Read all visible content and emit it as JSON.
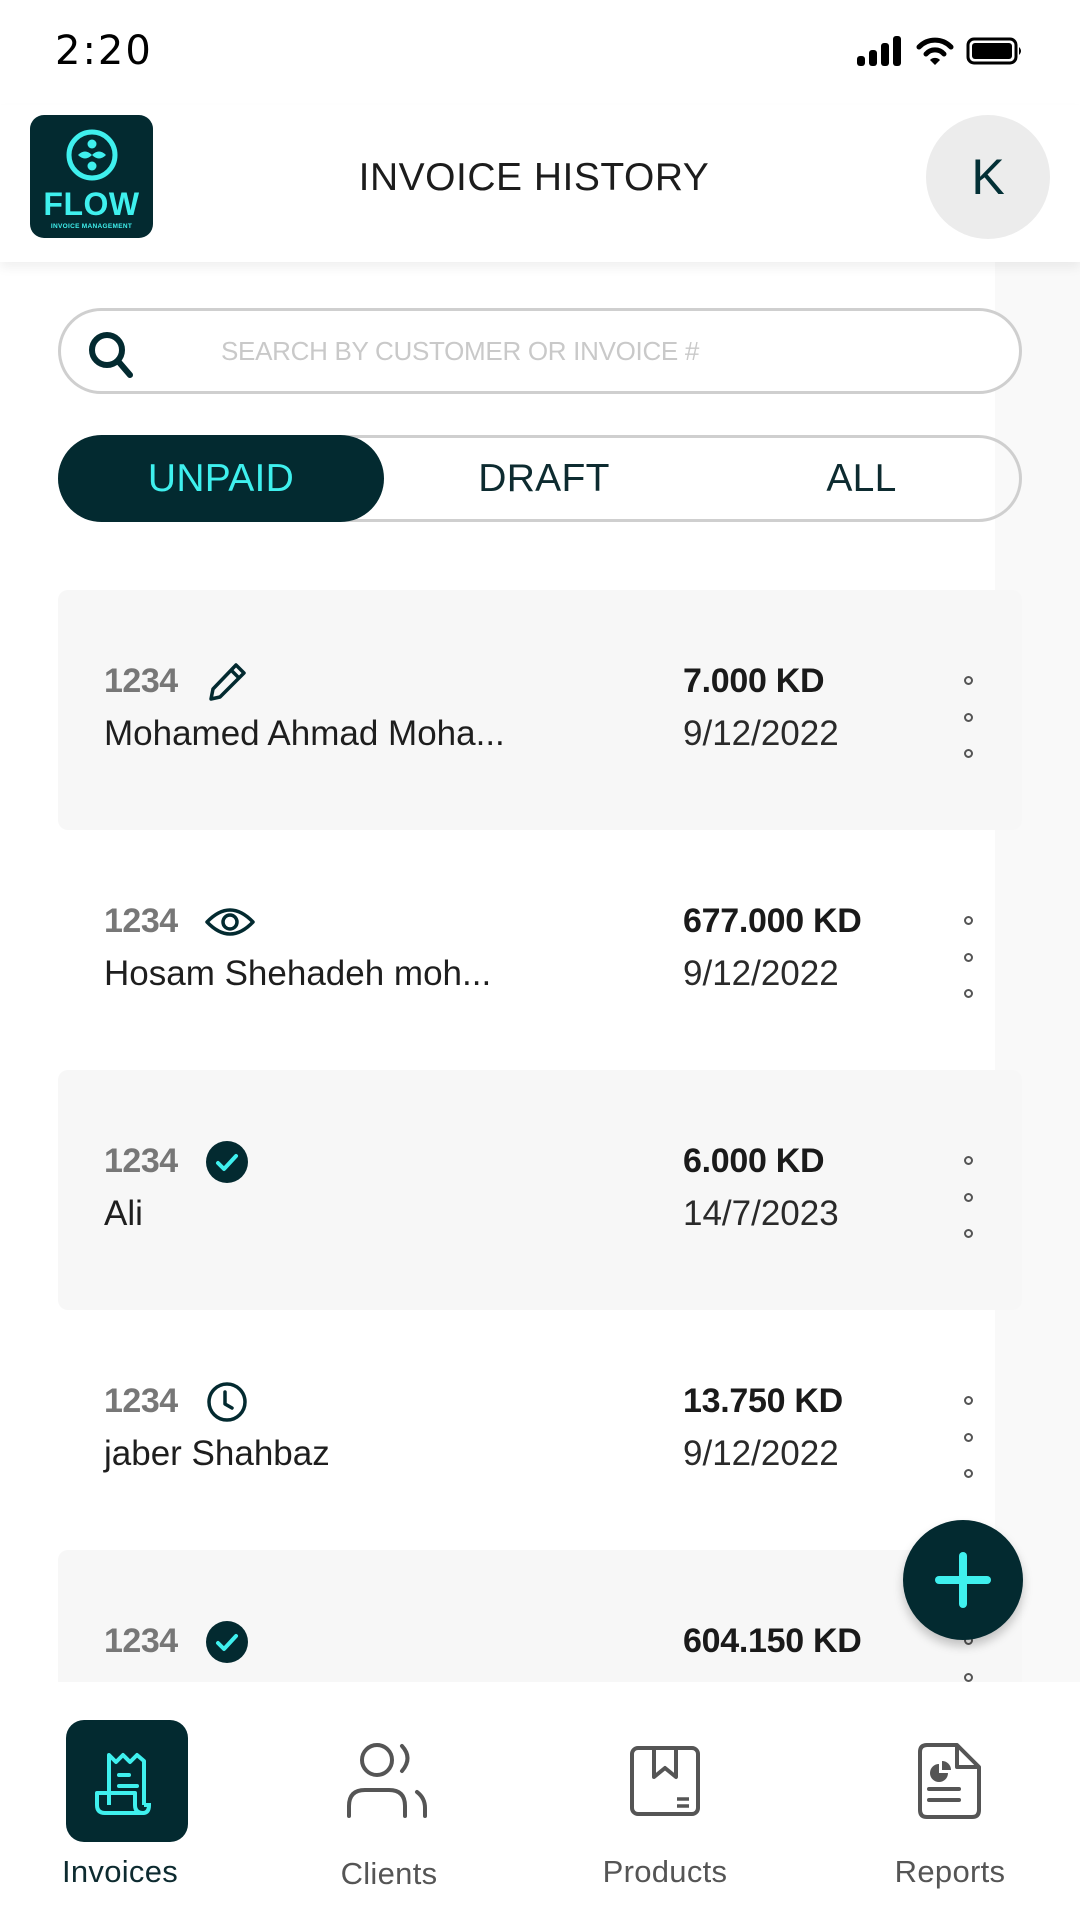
{
  "status_bar": {
    "time": "2:20",
    "icons": [
      "signal-icon",
      "wifi-icon",
      "battery-icon"
    ]
  },
  "header": {
    "logo": {
      "word": "FLOW",
      "subtitle": "INVOICE MANAGEMENT"
    },
    "title": "INVOICE HISTORY",
    "avatar_initial": "K"
  },
  "search": {
    "placeholder": "SEARCH BY CUSTOMER OR INVOICE #",
    "value": ""
  },
  "tabs": [
    {
      "label": "UNPAID",
      "active": true
    },
    {
      "label": "DRAFT",
      "active": false
    },
    {
      "label": "ALL",
      "active": false
    }
  ],
  "invoices": [
    {
      "number": "1234",
      "status_icon": "pencil-icon",
      "customer": "Mohamed Ahmad Moha...",
      "amount": "7.000 KD",
      "date": "9/12/2022"
    },
    {
      "number": "1234",
      "status_icon": "eye-icon",
      "customer": "Hosam Shehadeh moh...",
      "amount": "677.000 KD",
      "date": "9/12/2022"
    },
    {
      "number": "1234",
      "status_icon": "check-circle-icon",
      "customer": "Ali",
      "amount": "6.000 KD",
      "date": "14/7/2023"
    },
    {
      "number": "1234",
      "status_icon": "clock-icon",
      "customer": "jaber Shahbaz",
      "amount": "13.750 KD",
      "date": "9/12/2022"
    },
    {
      "number": "1234",
      "status_icon": "check-circle-icon",
      "customer": "",
      "amount": "604.150 KD",
      "date": ""
    }
  ],
  "fab": {
    "icon": "plus-icon"
  },
  "bottom_nav": [
    {
      "label": "Invoices",
      "icon": "receipt-icon",
      "active": true
    },
    {
      "label": "Clients",
      "icon": "users-icon",
      "active": false
    },
    {
      "label": "Products",
      "icon": "box-icon",
      "active": false
    },
    {
      "label": "Reports",
      "icon": "report-icon",
      "active": false
    }
  ],
  "colors": {
    "brand_dark": "#032a30",
    "brand_accent": "#3ff0ee",
    "card_shade": "#f7f7f7",
    "border": "#cfcfcf"
  }
}
